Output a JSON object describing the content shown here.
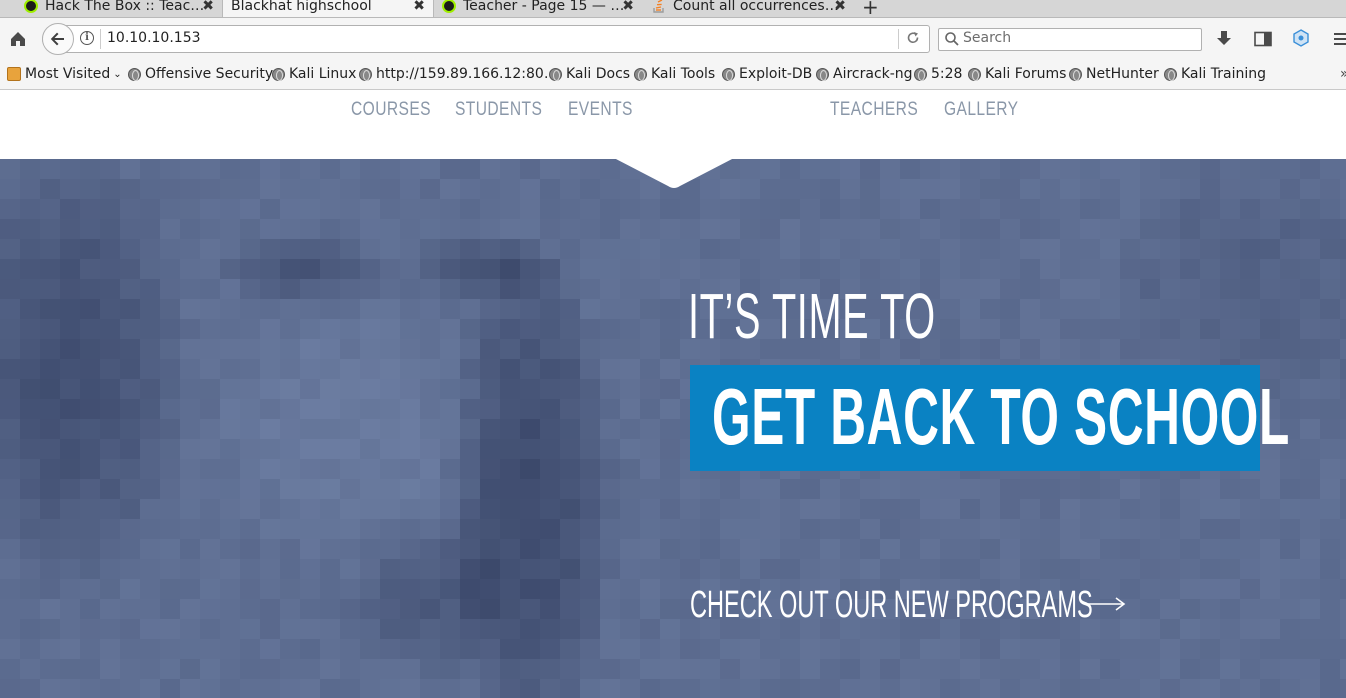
{
  "browser": {
    "tabs": [
      {
        "label": "Hack The Box :: Teac…",
        "favicon": "htb-icon",
        "active": false
      },
      {
        "label": "Blackhat highschool",
        "favicon": "",
        "active": true
      },
      {
        "label": "Teacher - Page 15 — …",
        "favicon": "htb-icon",
        "active": false
      },
      {
        "label": "Count all occurrences…",
        "favicon": "stackoverflow-icon",
        "active": false
      }
    ],
    "close_glyph": "✖",
    "new_tab_glyph": "+",
    "url": "10.10.10.153",
    "search_placeholder": "Search",
    "bookmarks": [
      {
        "label": "Most Visited"
      },
      {
        "label": "Offensive Security"
      },
      {
        "label": "Kali Linux"
      },
      {
        "label": "http://159.89.166.12:80…"
      },
      {
        "label": "Kali Docs"
      },
      {
        "label": "Kali Tools"
      },
      {
        "label": "Exploit-DB"
      },
      {
        "label": "Aircrack-ng"
      },
      {
        "label": "5:28"
      },
      {
        "label": "Kali Forums"
      },
      {
        "label": "NetHunter"
      },
      {
        "label": "Kali Training"
      }
    ],
    "bookmarks_overflow": "»"
  },
  "site": {
    "nav": [
      "COURSES",
      "STUDENTS",
      "EVENTS",
      "TEACHERS",
      "GALLERY"
    ],
    "hero": {
      "line1": "IT’S TIME TO",
      "line2": "GET BACK TO SCHOOL",
      "cta": "CHECK OUT OUR NEW PROGRAMS"
    },
    "colors": {
      "accent": "#0a82c3",
      "hero_bg": "#5a6b8e",
      "nav_text": "#8a97a8"
    }
  }
}
